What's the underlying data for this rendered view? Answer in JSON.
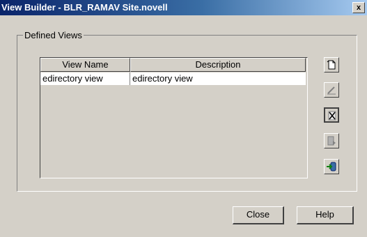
{
  "window": {
    "title": "View Builder - BLR_RAMAV Site.novell",
    "close_glyph": "x"
  },
  "group": {
    "legend": "Defined Views"
  },
  "table": {
    "columns": [
      "View Name",
      "Description"
    ],
    "rows": [
      {
        "view_name": "edirectory view",
        "description": "edirectory view"
      }
    ]
  },
  "side_buttons": [
    {
      "icon": "new-view-icon"
    },
    {
      "icon": "edit-view-icon"
    },
    {
      "icon": "delete-view-icon"
    },
    {
      "icon": "run-view-icon"
    },
    {
      "icon": "import-view-icon"
    }
  ],
  "footer": {
    "close_label": "Close",
    "help_label": "Help"
  }
}
